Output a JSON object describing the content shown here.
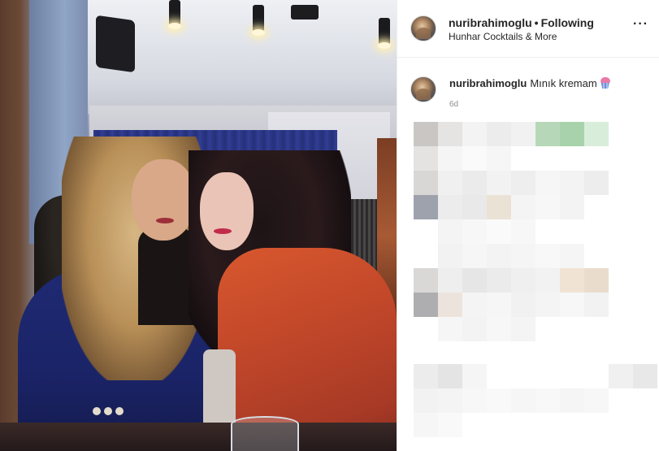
{
  "post": {
    "author": "nuribrahimoglu",
    "follow_status": "Following",
    "location": "Hunhar Cocktails & More"
  },
  "caption": {
    "author": "nuribrahimoglu",
    "text": "Mınık kremam",
    "emoji": "cupcake-icon",
    "time_ago": "6d"
  },
  "colors": {
    "text": "#262626",
    "muted": "#8e8e8e",
    "divider": "#efefef"
  }
}
